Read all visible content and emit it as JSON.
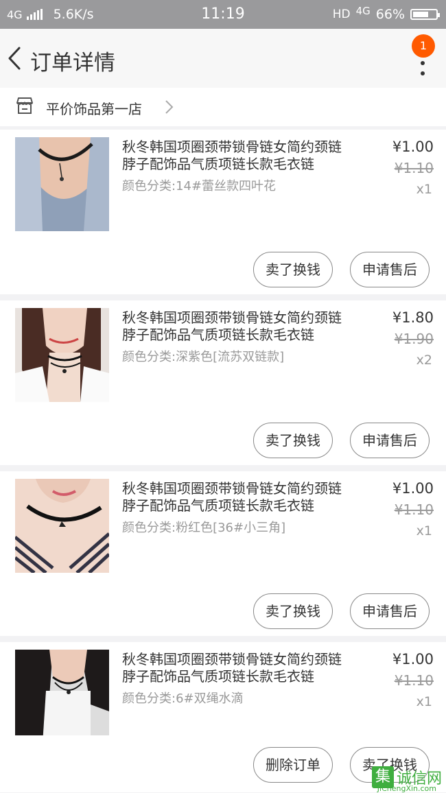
{
  "status_bar": {
    "network": "4G",
    "speed": "5.6K/s",
    "time": "11:19",
    "hd_label": "HD",
    "network_right": "4G",
    "battery": "66%"
  },
  "nav": {
    "title": "订单详情",
    "badge_count": "1"
  },
  "shop": {
    "name": "平价饰品第一店"
  },
  "items": [
    {
      "title": "秋冬韩国项圈颈带锁骨链女简约颈链脖子配饰品气质项链长款毛衣链",
      "spec": "颜色分类:14#蕾丝款四叶花",
      "price": "¥1.00",
      "original_price": "¥1.10",
      "quantity": "x1",
      "button_sell": "卖了换钱",
      "button_aftersale": "申请售后"
    },
    {
      "title": "秋冬韩国项圈颈带锁骨链女简约颈链脖子配饰品气质项链长款毛衣链",
      "spec": "颜色分类:深紫色[流苏双链款]",
      "price": "¥1.80",
      "original_price": "¥1.90",
      "quantity": "x2",
      "button_sell": "卖了换钱",
      "button_aftersale": "申请售后"
    },
    {
      "title": "秋冬韩国项圈颈带锁骨链女简约颈链脖子配饰品气质项链长款毛衣链",
      "spec": "颜色分类:粉红色[36#小三角]",
      "price": "¥1.00",
      "original_price": "¥1.10",
      "quantity": "x1",
      "button_sell": "卖了换钱",
      "button_aftersale": "申请售后"
    },
    {
      "title": "秋冬韩国项圈颈带锁骨链女简约颈链脖子配饰品气质项链长款毛衣链",
      "spec": "颜色分类:6#双绳水滴",
      "price": "¥1.00",
      "original_price": "¥1.10",
      "quantity": "x1"
    }
  ],
  "bottom_bar": {
    "delete_order": "删除订单",
    "sell_for_cash": "卖了换钱"
  },
  "watermark": {
    "box_char": "集",
    "text": "诚信网",
    "url": "JiChengXin.com"
  },
  "colors": {
    "accent": "#ff5a00",
    "status_bar_bg": "#9a9a9c",
    "page_bg": "#f2f2f4",
    "watermark_green": "#3fae3f"
  }
}
